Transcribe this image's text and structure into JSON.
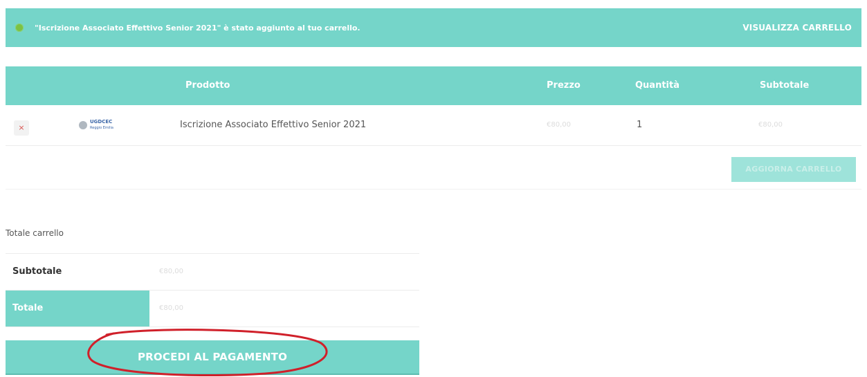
{
  "notice": {
    "message": "\"Iscrizione Associato Effettivo Senior 2021\" è stato aggiunto al tuo carrello.",
    "link": "VISUALIZZA CARRELLO"
  },
  "cart": {
    "headers": {
      "product": "Prodotto",
      "price": "Prezzo",
      "quantity": "Quantità",
      "subtotal": "Subtotale"
    },
    "items": [
      {
        "remove": "×",
        "logo": "UGDCEC",
        "logo_sub": "Reggio Emilia",
        "name": "Iscrizione Associato Effettivo Senior 2021",
        "price": "€80,00",
        "quantity": "1",
        "subtotal": "€80,00"
      }
    ],
    "update_button": "AGGIORNA CARRELLO"
  },
  "totals": {
    "title": "Totale carrello",
    "subtotal_label": "Subtotale",
    "subtotal_value": "€80,00",
    "total_label": "Totale",
    "total_value": "€80,00"
  },
  "checkout_button": "PROCEDI AL PAGAMENTO",
  "colors": {
    "accent": "#75d5c9",
    "annotation": "#d0202a"
  }
}
